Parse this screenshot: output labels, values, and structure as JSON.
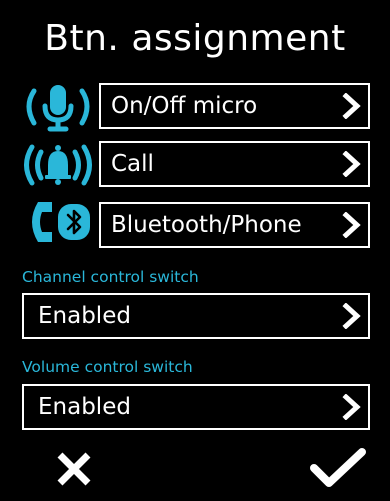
{
  "header": {
    "title": "Btn. assignment"
  },
  "buttons": [
    {
      "icon": "microphone-icon",
      "value": "On/Off micro"
    },
    {
      "icon": "bell-call-icon",
      "value": "Call"
    },
    {
      "icon": "phone-bluetooth-icon",
      "value": "Bluetooth/Phone"
    }
  ],
  "channel_control": {
    "label": "Channel control switch",
    "value": "Enabled"
  },
  "volume_control": {
    "label": "Volume control switch",
    "value": "Enabled"
  },
  "footer": {
    "cancel_icon": "close-icon",
    "confirm_icon": "check-icon"
  },
  "colors": {
    "accent": "#2ab7d9",
    "background": "#000000",
    "text": "#ffffff"
  }
}
